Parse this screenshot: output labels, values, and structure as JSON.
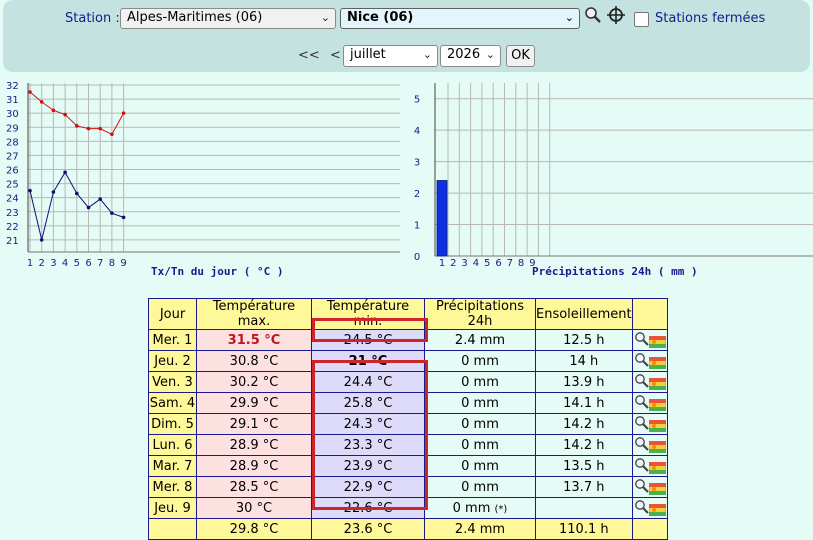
{
  "toolbar": {
    "station_label": "Station :",
    "department": "Alpes-Maritimes (06)",
    "station": "Nice (06)",
    "closed_label": "Stations fermées",
    "prev_year": "<<",
    "prev_month": "<",
    "month": "juillet",
    "year": "2026",
    "ok": "OK"
  },
  "temp_chart": {
    "title": "Tx/Tn du jour ( °C )",
    "days": [
      "1",
      "2",
      "3",
      "4",
      "5",
      "6",
      "7",
      "8",
      "9"
    ],
    "y_ticks": [
      "32",
      "31",
      "30",
      "29",
      "28",
      "27",
      "26",
      "25",
      "24",
      "23",
      "22",
      "21"
    ],
    "ylim": [
      20,
      32
    ],
    "tx_color": "#d01010",
    "tn_color": "#10106a"
  },
  "precip_chart": {
    "title": "Précipitations 24h ( mm )",
    "days": [
      "1",
      "2",
      "3",
      "4",
      "5",
      "6",
      "7",
      "8",
      "9"
    ],
    "y_ticks": [
      "5",
      "4",
      "3",
      "2",
      "1",
      "0"
    ],
    "ylim": [
      0,
      5.5
    ],
    "bar_color": "#1030e0"
  },
  "table": {
    "headers": [
      "Jour",
      "Température max.",
      "Température min.",
      "Précipitations 24h",
      "Ensoleillement"
    ],
    "rows": [
      {
        "day": "Mer. 1",
        "tx": "31.5 °C",
        "tn": "24.5 °C",
        "rr": "2.4 mm",
        "rr_note": "",
        "sun": "12.5 h"
      },
      {
        "day": "Jeu. 2",
        "tx": "30.8 °C",
        "tn": "21 °C",
        "rr": "0 mm",
        "rr_note": "",
        "sun": "14 h"
      },
      {
        "day": "Ven. 3",
        "tx": "30.2 °C",
        "tn": "24.4 °C",
        "rr": "0 mm",
        "rr_note": "",
        "sun": "13.9 h"
      },
      {
        "day": "Sam. 4",
        "tx": "29.9 °C",
        "tn": "25.8 °C",
        "rr": "0 mm",
        "rr_note": "",
        "sun": "14.1 h"
      },
      {
        "day": "Dim. 5",
        "tx": "29.1 °C",
        "tn": "24.3 °C",
        "rr": "0 mm",
        "rr_note": "",
        "sun": "14.2 h"
      },
      {
        "day": "Lun. 6",
        "tx": "28.9 °C",
        "tn": "23.3 °C",
        "rr": "0 mm",
        "rr_note": "",
        "sun": "14.2 h"
      },
      {
        "day": "Mar. 7",
        "tx": "28.9 °C",
        "tn": "23.9 °C",
        "rr": "0 mm",
        "rr_note": "",
        "sun": "13.5 h"
      },
      {
        "day": "Mer. 8",
        "tx": "28.5 °C",
        "tn": "22.9 °C",
        "rr": "0 mm",
        "rr_note": "",
        "sun": "13.7 h"
      },
      {
        "day": "Jeu. 9",
        "tx": "30 °C",
        "tn": "22.6 °C",
        "rr": "0 mm",
        "rr_note": "(*)",
        "sun": ""
      }
    ],
    "totals": {
      "tx": "29.8 °C",
      "tn": "23.6 °C",
      "rr": "2.4 mm",
      "sun": "110.1 h"
    }
  },
  "chart_data": [
    {
      "type": "line",
      "title": "Tx/Tn du jour ( °C )",
      "x": [
        1,
        2,
        3,
        4,
        5,
        6,
        7,
        8,
        9
      ],
      "series": [
        {
          "name": "Tx",
          "values": [
            31.5,
            30.8,
            30.2,
            29.9,
            29.1,
            28.9,
            28.9,
            28.5,
            30.0
          ]
        },
        {
          "name": "Tn",
          "values": [
            24.5,
            21.0,
            24.4,
            25.8,
            24.3,
            23.3,
            23.9,
            22.9,
            22.6
          ]
        }
      ],
      "ylim": [
        20,
        32
      ],
      "grid": true
    },
    {
      "type": "bar",
      "title": "Précipitations 24h ( mm )",
      "x": [
        1,
        2,
        3,
        4,
        5,
        6,
        7,
        8,
        9
      ],
      "values": [
        2.4,
        0,
        0,
        0,
        0,
        0,
        0,
        0,
        0
      ],
      "ylim": [
        0,
        5.5
      ],
      "grid": true
    }
  ]
}
